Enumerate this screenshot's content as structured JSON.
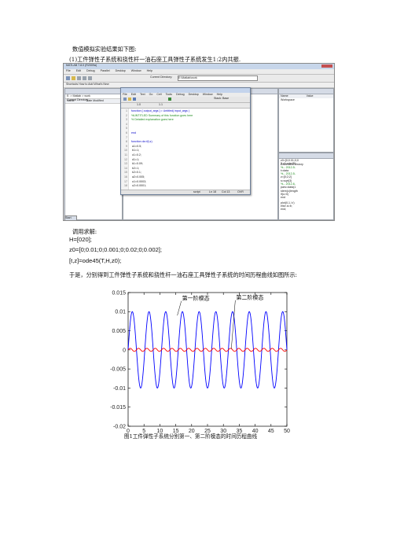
{
  "document": {
    "intro_line": "数值模拟实验结果如下图:",
    "caption1": "(1)工件弹性子系统和挠性杆一油石座工具弹性子系统发生1:2内共振.",
    "call_heading": "调用求解:",
    "code_lines": [
      "H=[020];",
      "z0=[0;0.01;0;0.001;0;0.02;0;0.002];",
      "[t,z]=ode45(T,H,z0);"
    ],
    "result_text": "于是，分别得到工件弹性子系统和挠性杆一油石座工具弹性子系统的时间历程曲线如图所示:",
    "figure_caption": "图1工件弹性子系统分别第一、第二阶模态的时间历程曲线"
  },
  "matlab_screenshot": {
    "window_title": "MATLAB 7.8.0 (R2009a)",
    "menu_items": [
      "File",
      "Edit",
      "Debug",
      "Parallel",
      "Desktop",
      "Window",
      "Help"
    ],
    "current_directory_label": "Current Directory:",
    "current_directory_value": "E:\\Matlab\\work",
    "shortcuts_text": "Shortcuts  How to Add  What's New",
    "left_pane_title": "Current Directory",
    "left_path": "E: > Matlab > work",
    "left_columns": [
      "Name",
      "Date Modified"
    ],
    "editor_title": "Editor - Untitled*",
    "editor_menu": [
      "File",
      "Edit",
      "Text",
      "Go",
      "Cell",
      "Tools",
      "Debug",
      "Desktop",
      "Window",
      "Help"
    ],
    "editor_zoom": "1.0",
    "editor_zoom2": "1.1",
    "editor_stack": "Stack: Base",
    "editor_lines": [
      {
        "n": "1",
        "text": "function [ output_args ] = Untitled( input_args )",
        "cls": "blue"
      },
      {
        "n": "2",
        "text": "%UNTITLED Summary of this function goes here",
        "cls": "green"
      },
      {
        "n": "3",
        "text": "%   Detailed explanation goes here",
        "cls": "green"
      },
      {
        "n": "4",
        "text": "",
        "cls": ""
      },
      {
        "n": "5",
        "text": "",
        "cls": ""
      },
      {
        "n": "6",
        "text": "end",
        "cls": "blue"
      },
      {
        "n": "7",
        "text": "",
        "cls": ""
      },
      {
        "n": "8",
        "text": "function dz=f(t,z)",
        "cls": "blue"
      },
      {
        "n": "9",
        "text": "  a1=0.5;",
        "cls": ""
      },
      {
        "n": "10",
        "text": "  b1=1;",
        "cls": ""
      },
      {
        "n": "11",
        "text": "  c1=0.2;",
        "cls": ""
      },
      {
        "n": "12",
        "text": "  d1=1;",
        "cls": ""
      },
      {
        "n": "13",
        "text": "  k1=0.09;",
        "cls": ""
      },
      {
        "n": "14",
        "text": "  b2=1;",
        "cls": ""
      },
      {
        "n": "15",
        "text": "  k2=0.1;",
        "cls": ""
      },
      {
        "n": "16",
        "text": "  a2=0.005;",
        "cls": ""
      },
      {
        "n": "17",
        "text": "  u1=0.0003;",
        "cls": ""
      },
      {
        "n": "18",
        "text": "  u2=0.0001;",
        "cls": ""
      }
    ],
    "editor_status_script": "script",
    "editor_status_ln": "Ln 18",
    "editor_status_col": "Col 13",
    "editor_status_ovr": "OVR",
    "workspace_title": "Workspace",
    "workspace_columns": [
      "Name",
      "Value"
    ],
    "history_title": "Command History",
    "history_lines": [
      "z0=[0;0.01;0;0",
      "[t,z]=ode45(",
      "%-- 2012-5-",
      "t=data",
      "%-- 2012-5-",
      "z=[0;2;2]",
      "s=sqrt(3)",
      "%-- 2012-6-",
      "pars=data(1",
      "stem(c(length",
      "  if(c>0)",
      "  end"
    ],
    "history_bottom": [
      "plot(0,1,'o')",
      "else a=b;",
      "end;"
    ],
    "command_title": "Command Window",
    "start_button": "Start"
  },
  "chart_data": {
    "type": "line",
    "title": "",
    "xlabel": "",
    "ylabel": "",
    "xlim": [
      0,
      50
    ],
    "ylim": [
      -0.02,
      0.015
    ],
    "xticks": [
      0,
      5,
      10,
      15,
      20,
      25,
      30,
      35,
      40,
      45,
      50
    ],
    "yticks": [
      0.015,
      0.01,
      0.005,
      0,
      -0.005,
      -0.01,
      -0.015,
      -0.02
    ],
    "ytick_labels": [
      "0.015",
      "0.01",
      "0.005",
      "0",
      "-0.005",
      "-0.01",
      "-0.015",
      "-0.02"
    ],
    "series": [
      {
        "name": "第一阶模态",
        "color": "#0000ff",
        "amplitude": 0.01,
        "cycles": 9.5,
        "phase": 0
      },
      {
        "name": "第二阶模态",
        "color": "#ff0000",
        "amplitude": 0.0004,
        "cycles": 19,
        "phase": 0
      }
    ],
    "annotations": [
      {
        "text": "第一阶模态",
        "at_x": 17,
        "at_y": 0.013,
        "points_to_x": 15.5,
        "points_to_y": 0.009
      },
      {
        "text": "第二阶模态",
        "at_x": 34,
        "at_y": 0.0132,
        "points_to_x": 32.5,
        "points_to_y": 0.0003
      }
    ]
  }
}
